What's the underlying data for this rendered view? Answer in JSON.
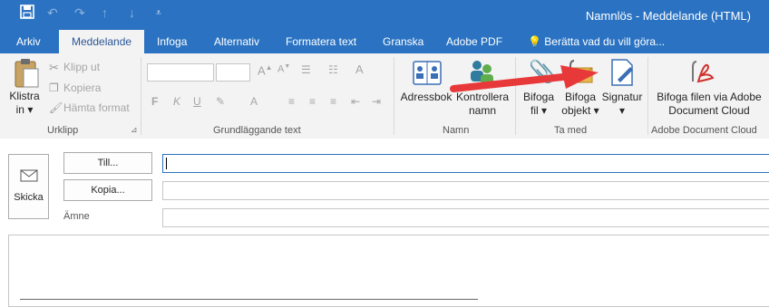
{
  "window": {
    "title": "Namnlös - Meddelande (HTML)"
  },
  "tabs": [
    {
      "label": "Arkiv"
    },
    {
      "label": "Meddelande"
    },
    {
      "label": "Infoga"
    },
    {
      "label": "Alternativ"
    },
    {
      "label": "Formatera text"
    },
    {
      "label": "Granska"
    },
    {
      "label": "Adobe PDF"
    }
  ],
  "tellme": {
    "label": "Berätta vad du vill göra..."
  },
  "ribbon": {
    "clipboard": {
      "paste_line1": "Klistra",
      "paste_line2": "in",
      "cut": "Klipp ut",
      "copy": "Kopiera",
      "format_painter": "Hämta format",
      "group": "Urklipp"
    },
    "basic_text": {
      "group": "Grundläggande text"
    },
    "names": {
      "address_book": "Adressbok",
      "check_names_line1": "Kontrollera",
      "check_names_line2": "namn",
      "group": "Namn"
    },
    "include": {
      "attach_file_line1": "Bifoga",
      "attach_file_line2": "fil",
      "attach_item_line1": "Bifoga",
      "attach_item_line2": "objekt",
      "signature": "Signatur",
      "group": "Ta med"
    },
    "adobe": {
      "attach_line1": "Bifoga filen via Adobe",
      "attach_line2": "Document Cloud",
      "group": "Adobe Document Cloud"
    }
  },
  "compose": {
    "send": "Skicka",
    "to": "Till...",
    "cc": "Kopia...",
    "subject": "Ämne",
    "to_value": "",
    "cc_value": "",
    "subject_value": ""
  },
  "colors": {
    "accent": "#2b73c2",
    "arrow": "#e8393a"
  },
  "icons": [
    "save-icon",
    "undo-icon",
    "redo-icon",
    "up-icon",
    "down-icon",
    "customize-icon",
    "lightbulb-icon",
    "paste-icon",
    "scissors-icon",
    "copy-icon",
    "format-painter-icon",
    "address-book-icon",
    "check-names-icon",
    "paperclip-icon",
    "attach-item-icon",
    "signature-icon",
    "adobe-attach-icon",
    "envelope-icon"
  ]
}
